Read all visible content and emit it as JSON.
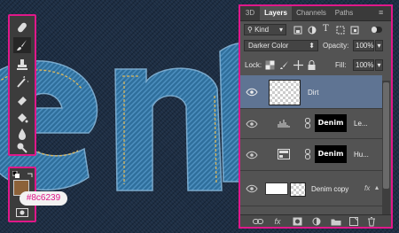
{
  "canvas": {
    "letters_visible": "enm"
  },
  "colors": {
    "accent": "#e0188a",
    "foreground_swatch": "#8c6239",
    "panel_bg": "#535353",
    "selected_row": "#5f7493"
  },
  "color_label": "#8c6239",
  "tools": [
    {
      "name": "spot-healing-brush-icon"
    },
    {
      "name": "brush-icon"
    },
    {
      "name": "clone-stamp-icon"
    },
    {
      "name": "history-brush-icon"
    },
    {
      "name": "eraser-icon"
    },
    {
      "name": "paint-bucket-icon"
    },
    {
      "name": "blur-icon"
    },
    {
      "name": "dodge-icon"
    }
  ],
  "panel": {
    "tabs": [
      "3D",
      "Layers",
      "Channels",
      "Paths"
    ],
    "active_tab": "Layers",
    "filter_label": "Kind",
    "blend_mode": "Darker Color",
    "opacity_label": "Opacity:",
    "opacity_value": "100%",
    "lock_label": "Lock:",
    "fill_label": "Fill:",
    "fill_value": "100%",
    "layers": [
      {
        "name": "Dirt",
        "selected": true
      },
      {
        "name": "Le...",
        "thumb_text": "Denim"
      },
      {
        "name": "Hu...",
        "thumb_text": "Denim"
      },
      {
        "name": "Denim copy",
        "fx": "fx"
      }
    ],
    "bottom_fx": "fx"
  }
}
